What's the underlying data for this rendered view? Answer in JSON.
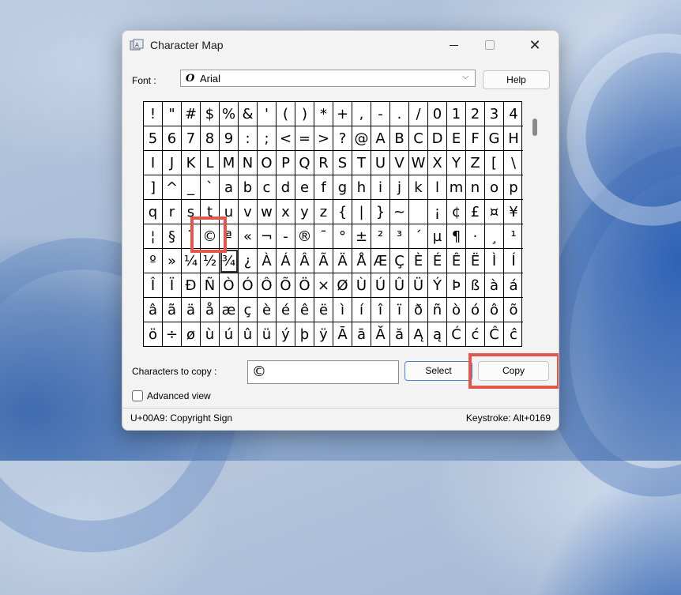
{
  "window": {
    "title": "Character Map",
    "close_glyph": "✕"
  },
  "font": {
    "label": "Font :",
    "glyph": "O",
    "selected": "Arial",
    "chevron": "⌵"
  },
  "help_label": "Help",
  "grid": {
    "selected_index": 124,
    "cells": [
      "!",
      "\"",
      "#",
      "$",
      "%",
      "&",
      "'",
      "(",
      ")",
      "*",
      "+",
      ",",
      "-",
      ".",
      "/",
      "0",
      "1",
      "2",
      "3",
      "4",
      "5",
      "6",
      "7",
      "8",
      "9",
      ":",
      ";",
      "<",
      "=",
      ">",
      "?",
      "@",
      "A",
      "B",
      "C",
      "D",
      "E",
      "F",
      "G",
      "H",
      "I",
      "J",
      "K",
      "L",
      "M",
      "N",
      "O",
      "P",
      "Q",
      "R",
      "S",
      "T",
      "U",
      "V",
      "W",
      "X",
      "Y",
      "Z",
      "[",
      "\\",
      "]",
      "^",
      "_",
      "`",
      "a",
      "b",
      "c",
      "d",
      "e",
      "f",
      "g",
      "h",
      "i",
      "j",
      "k",
      "l",
      "m",
      "n",
      "o",
      "p",
      "q",
      "r",
      "s",
      "t",
      "u",
      "v",
      "w",
      "x",
      "y",
      "z",
      "{",
      "|",
      "}",
      "~",
      " ",
      "¡",
      "¢",
      "£",
      "¤",
      "¥",
      "¦",
      "§",
      "¨",
      "©",
      "ª",
      "«",
      "¬",
      "-",
      "®",
      "¯",
      "°",
      "±",
      "²",
      "³",
      "´",
      "µ",
      "¶",
      "·",
      "¸",
      "¹",
      "º",
      "»",
      "¼",
      "½",
      "¾",
      "¿",
      "À",
      "Á",
      "Â",
      "Ã",
      "Ä",
      "Å",
      "Æ",
      "Ç",
      "È",
      "É",
      "Ê",
      "Ë",
      "Ì",
      "Í",
      "Î",
      "Ï",
      "Ð",
      "Ñ",
      "Ò",
      "Ó",
      "Ô",
      "Õ",
      "Ö",
      "×",
      "Ø",
      "Ù",
      "Ú",
      "Û",
      "Ü",
      "Ý",
      "Þ",
      "ß",
      "à",
      "á",
      "â",
      "ã",
      "ä",
      "å",
      "æ",
      "ç",
      "è",
      "é",
      "ê",
      "ë",
      "ì",
      "í",
      "î",
      "ï",
      "ð",
      "ñ",
      "ò",
      "ó",
      "ô",
      "õ",
      "ö",
      "÷",
      "ø",
      "ù",
      "ú",
      "û",
      "ü",
      "ý",
      "þ",
      "ÿ",
      "Ā",
      "ā",
      "Ă",
      "ă",
      "Ą",
      "ą",
      "Ć",
      "ć",
      "Ĉ",
      "ĉ"
    ]
  },
  "copy": {
    "label": "Characters to copy :",
    "value": "©",
    "select_label": "Select",
    "copy_label": "Copy"
  },
  "advanced_view": {
    "label": "Advanced view",
    "checked": false
  },
  "status": {
    "left": "U+00A9: Copyright Sign",
    "right": "Keystroke: Alt+0169"
  },
  "colors": {
    "highlight": "#e2574c",
    "select_border": "#4a7fc9"
  }
}
